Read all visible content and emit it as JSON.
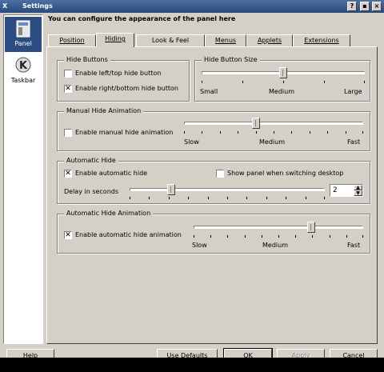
{
  "window": {
    "title": "Settings",
    "app_icon": "X"
  },
  "sidebar": {
    "items": [
      {
        "label": "Panel",
        "icon": "panel-icon",
        "active": true
      },
      {
        "label": "Taskbar",
        "icon": "taskbar-icon",
        "active": false
      }
    ]
  },
  "heading": "You can configure the appearance of the panel here",
  "tabs": [
    "Position",
    "Hiding",
    "Look & Feel",
    "Menus",
    "Applets",
    "Extensions"
  ],
  "active_tab": "Hiding",
  "hide_buttons": {
    "title": "Hide Buttons",
    "left_top": {
      "label": "Enable left/top hide button",
      "checked": false
    },
    "right_bottom": {
      "label": "Enable right/bottom hide button",
      "checked": true
    }
  },
  "hide_button_size": {
    "title": "Hide Button Size",
    "labels": [
      "Small",
      "Medium",
      "Large"
    ],
    "value_fraction": 0.5
  },
  "manual_hide_animation": {
    "title": "Manual Hide Animation",
    "checkbox": {
      "label": "Enable manual hide animation",
      "checked": false
    },
    "labels": [
      "Slow",
      "Medium",
      "Fast"
    ],
    "value_fraction": 0.4
  },
  "automatic_hide": {
    "title": "Automatic Hide",
    "enable": {
      "label": "Enable automatic hide",
      "checked": true
    },
    "show_when_switching": {
      "label": "Show panel when switching desktop",
      "checked": false
    },
    "delay_label": "Delay in seconds",
    "delay_value": "2",
    "value_fraction": 0.2
  },
  "automatic_hide_animation": {
    "title": "Automatic Hide Animation",
    "checkbox": {
      "label": "Enable automatic hide animation",
      "checked": true
    },
    "labels": [
      "Slow",
      "Medium",
      "Fast"
    ],
    "value_fraction": 0.7
  },
  "buttons": {
    "help": "Help",
    "use_defaults": "Use Defaults",
    "ok": "OK",
    "apply": "Apply",
    "cancel": "Cancel"
  },
  "titlebar_buttons": {
    "help": "?",
    "minimize": "▪",
    "close": "×"
  }
}
